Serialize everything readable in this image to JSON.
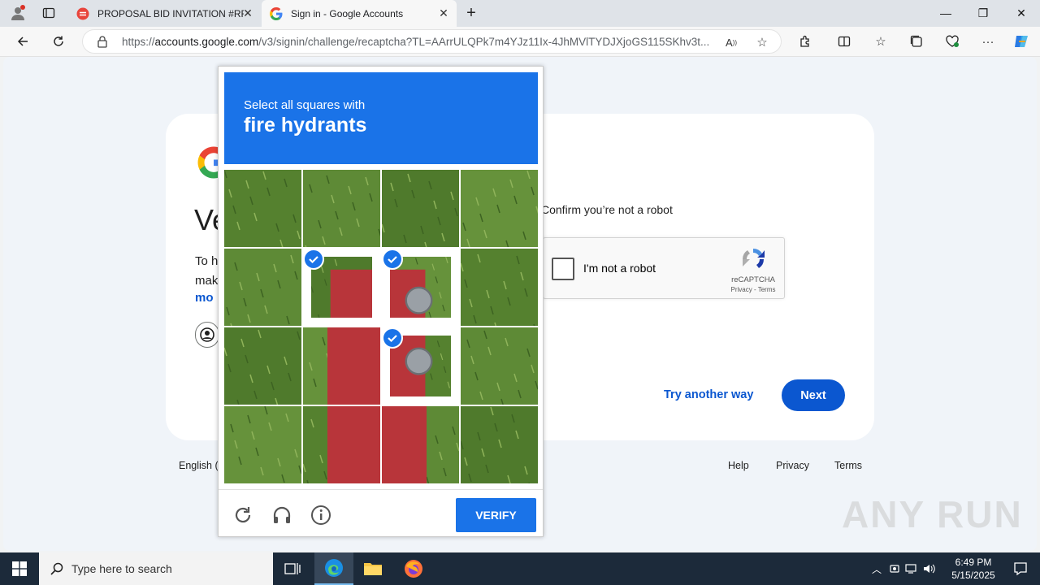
{
  "browser": {
    "tabs": [
      {
        "title": "PROPOSAL BID INVITATION #RFP",
        "active": false
      },
      {
        "title": "Sign in - Google Accounts",
        "active": true
      }
    ],
    "url_prefix": "https://",
    "url_host": "accounts.google.com",
    "url_path": "/v3/signin/challenge/recaptcha?TL=AArrULQPk7m4YJz11Ix-4JhMVlTYDJXjoGS115SKhv3t..."
  },
  "page": {
    "heading_fragment": "Ve",
    "para_line1": "To h",
    "para_line2": "mak",
    "link_fragment": "mo",
    "confirm_text": "Confirm you’re not a robot",
    "recaptcha": {
      "label": "I'm not a robot",
      "brand": "reCAPTCHA",
      "links": "Privacy - Terms"
    },
    "try_another_way": "Try another way",
    "next": "Next",
    "footer": {
      "language": "English (",
      "help": "Help",
      "privacy": "Privacy",
      "terms": "Terms"
    }
  },
  "captcha": {
    "instruction_small": "Select all squares with",
    "instruction_big": "fire hydrants",
    "grid_rows": 4,
    "grid_cols": 4,
    "selected_tiles": [
      5,
      6,
      10
    ],
    "verify_label": "VERIFY",
    "icons": [
      "reload-icon",
      "audio-icon",
      "info-icon"
    ]
  },
  "watermark": "ANY RUN",
  "taskbar": {
    "search_placeholder": "Type here to search",
    "time": "6:49 PM",
    "date": "5/15/2025"
  },
  "colors": {
    "captcha_blue": "#1a73e8",
    "google_blue": "#0b57d0",
    "taskbar": "#1c2a3a"
  }
}
